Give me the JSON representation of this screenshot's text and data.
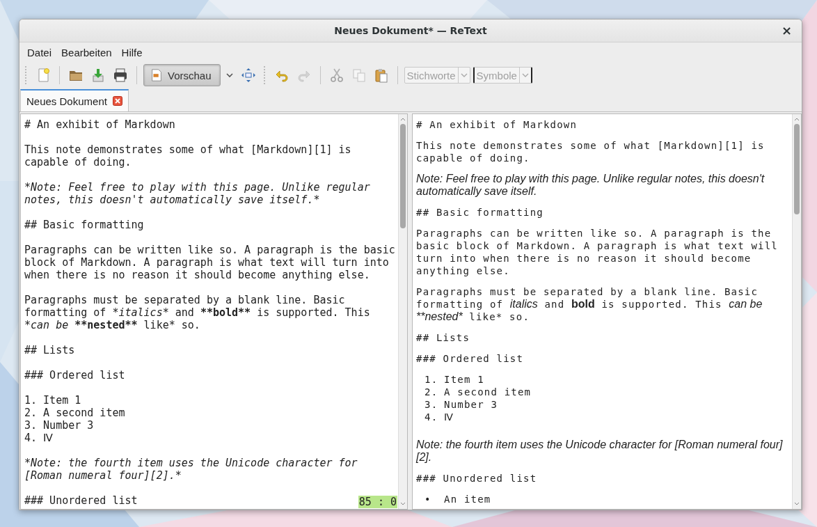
{
  "window": {
    "title": "Neues Dokument* — ReText",
    "close": "×"
  },
  "menu": [
    "Datei",
    "Bearbeiten",
    "Hilfe"
  ],
  "toolbar": [
    {
      "kind": "grip"
    },
    {
      "kind": "new",
      "disabled": false
    },
    {
      "kind": "separator"
    },
    {
      "kind": "open",
      "disabled": false
    },
    {
      "kind": "save",
      "disabled": false
    },
    {
      "kind": "print",
      "disabled": false
    },
    {
      "kind": "separator"
    },
    {
      "kind": "toggle",
      "label": "Vorschau",
      "checked": true
    },
    {
      "kind": "dropdown",
      "disabled": false
    },
    {
      "kind": "fullscreen",
      "disabled": false
    },
    {
      "kind": "grip"
    },
    {
      "kind": "undo",
      "disabled": false
    },
    {
      "kind": "redo",
      "disabled": true
    },
    {
      "kind": "separator"
    },
    {
      "kind": "cut",
      "disabled": true
    },
    {
      "kind": "copy",
      "disabled": true
    },
    {
      "kind": "paste",
      "disabled": false
    },
    {
      "kind": "separator"
    },
    {
      "kind": "combo",
      "label": "Stichworte",
      "disabled": true,
      "focused": false
    },
    {
      "kind": "combo",
      "label": "Symbole",
      "disabled": true,
      "focused": true
    }
  ],
  "tabs": [
    {
      "label": "Neues Dokument",
      "selected": true
    }
  ],
  "editor": {
    "blocks": [
      [
        [
          "# An exhibit of Markdown"
        ]
      ],
      [
        [
          "This note demonstrates some of what [Markdown][1] is"
        ],
        [
          "capable of doing."
        ]
      ],
      [
        [
          {
            "text": "*Note: Feel free to play with this page. Unlike regular",
            "kind": "emphasis"
          }
        ],
        [
          {
            "text": "notes, this doesn't automatically save itself.*",
            "kind": "emphasis"
          }
        ]
      ],
      [
        [
          "## Basic formatting"
        ]
      ],
      [
        [
          "Paragraphs can be written like so. A paragraph is the basic"
        ],
        [
          "block of Markdown. A paragraph is what text will turn into"
        ],
        [
          "when there is no reason it should become anything else."
        ]
      ],
      [
        [
          "Paragraphs must be separated by a blank line. Basic"
        ],
        [
          "formatting of ",
          {
            "text": "*italics*",
            "kind": "emphasis"
          },
          " and ",
          {
            "text": "**bold**",
            "kind": "strong"
          },
          " is supported. This"
        ],
        [
          {
            "text": "*can be ",
            "kind": "emphasis"
          },
          {
            "text": "**nested**",
            "kind": "strong"
          },
          " like* so."
        ]
      ],
      [
        [
          "## Lists"
        ]
      ],
      [
        [
          "### Ordered list"
        ]
      ],
      [
        [
          "1. Item 1"
        ],
        [
          "2. A second item"
        ],
        [
          "3. Number 3"
        ],
        [
          "4. Ⅳ"
        ]
      ],
      [
        [
          {
            "text": "*Note: the fourth item uses the Unicode character for",
            "kind": "emphasis"
          }
        ],
        [
          {
            "text": "[Roman numeral four][2].*",
            "kind": "emphasis"
          }
        ]
      ],
      [
        [
          "### Unordered list"
        ]
      ]
    ],
    "cursor": "85 : 0"
  },
  "preview": [
    {
      "kind": "text",
      "lines": [
        [
          "# An exhibit of Markdown"
        ]
      ]
    },
    {
      "kind": "text",
      "lines": [
        [
          "This note demonstrates some of what [Markdown][1] is"
        ],
        [
          "capable of doing."
        ]
      ]
    },
    {
      "kind": "note",
      "lines": [
        [
          "Note: Feel free to play with this page. Unlike regular notes, this doesn't"
        ],
        [
          "automatically save itself."
        ]
      ]
    },
    {
      "kind": "text",
      "lines": [
        [
          "## Basic formatting"
        ]
      ]
    },
    {
      "kind": "text",
      "lines": [
        [
          "Paragraphs can be written like so. A paragraph is the"
        ],
        [
          "basic block of Markdown. A paragraph is what text will"
        ],
        [
          "turn into when there is no reason it should become"
        ],
        [
          "anything else."
        ]
      ]
    },
    {
      "kind": "text",
      "lines": [
        [
          "Paragraphs must be separated by a blank line. Basic"
        ],
        [
          "formatting of ",
          {
            "text": "italics",
            "kind": "emphasis"
          },
          " and ",
          {
            "text": "bold",
            "kind": "strong"
          },
          " is supported. This ",
          {
            "text": "can be",
            "kind": "emphasis"
          }
        ],
        [
          {
            "text": "**nested*",
            "kind": "emphasis"
          },
          " like* so."
        ]
      ]
    },
    {
      "kind": "text",
      "lines": [
        [
          "## Lists"
        ]
      ]
    },
    {
      "kind": "text",
      "lines": [
        [
          "### Ordered list"
        ]
      ]
    },
    {
      "kind": "list",
      "items": [
        {
          "marker": "1.",
          "text": "Item 1"
        },
        {
          "marker": "2.",
          "text": "A second item"
        },
        {
          "marker": "3.",
          "text": "Number 3"
        },
        {
          "marker": "4.",
          "text": "Ⅳ"
        }
      ]
    },
    {
      "kind": "note",
      "lines": [
        [
          "Note: the fourth item uses the Unicode character for [Roman numeral four]"
        ],
        [
          "[2]."
        ]
      ]
    },
    {
      "kind": "text",
      "lines": [
        [
          "### Unordered list"
        ]
      ]
    },
    {
      "kind": "list",
      "items": [
        {
          "marker": "•",
          "text": "An item"
        }
      ]
    }
  ]
}
